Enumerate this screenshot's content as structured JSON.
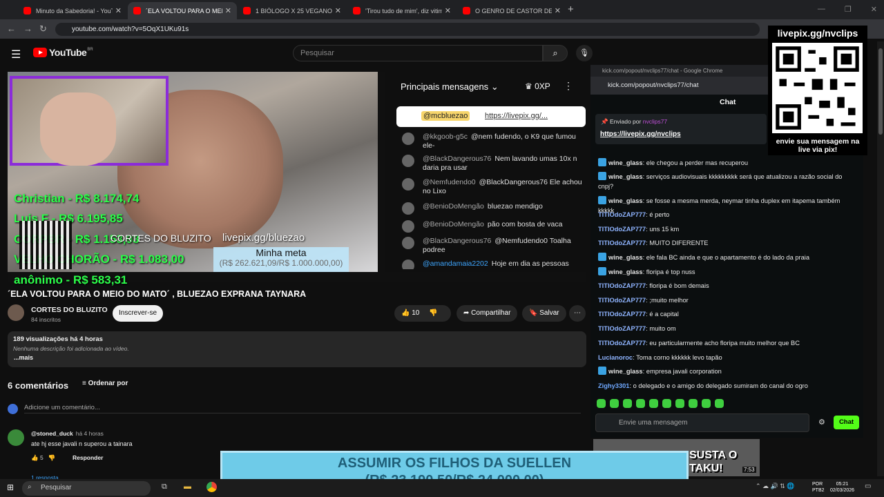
{
  "browser": {
    "tabs": [
      {
        "label": "Minuto da Sabedoria! - YouTub"
      },
      {
        "label": "´ELA VOLTOU PARA O MEIO"
      },
      {
        "label": "1 BIÓLOGO X 25 VEGANOS | FI"
      },
      {
        "label": "'Tirou tudo de mim', diz vitima"
      },
      {
        "label": "O GENRO DE CASTOR DE ANDI"
      }
    ],
    "url": "youtube.com/watch?v=5OqX1UKu91s"
  },
  "youtube": {
    "logo": "YouTube",
    "region": "BR",
    "search_placeholder": "Pesquisar"
  },
  "video": {
    "donors": [
      "Christian - R$ 8.174,74",
      "Luis F - R$ 6.195,85",
      "CORPBR - R$ 1.153,93",
      "VELHO CHORÃO - R$ 1.083,00",
      "anônimo - R$ 583,31"
    ],
    "overlay_channel": "CORTES DO BLUZITO",
    "overlay_link": "livepix.gg/bluezao",
    "meta_label": "Minha meta",
    "meta_value": "(R$ 262.621,09/R$ 1.000.000,00)"
  },
  "live_chat": {
    "title": "Principais mensagens",
    "xp": "0XP",
    "pinned_author": "@mcbluezao",
    "pinned_link": "https://livepix.gg/...",
    "messages": [
      {
        "author": "@kkgoob-g5c",
        "text": "@nem fudendo, o K9 que fumou ele-"
      },
      {
        "author": "@BlackDangerous76",
        "text": "Nem lavando umas 10x n daria pra usar"
      },
      {
        "author": "@Nemfudendo0",
        "text": "@BlackDangerous76 Ele achou no Lixo"
      },
      {
        "author": "@BenioDoMengão",
        "text": "bluezao mendigo"
      },
      {
        "author": "@BenioDoMengão",
        "text": "pão com bosta de vaca"
      },
      {
        "author": "@BlackDangerous76",
        "text": "@Nemfudendo0 Toalha podree"
      },
      {
        "author": "@amandamaia2202",
        "text": "Hoje em dia as pessoas"
      }
    ]
  },
  "watch": {
    "title": "´ELA VOLTOU PARA O MEIO DO MATO´ , BLUEZAO EXPRANA TAYNARA",
    "channel": "CORTES DO BLUZITO",
    "subs": "84 inscritos",
    "subscribe": "Inscrever-se",
    "likes": "10",
    "share": "Compartilhar",
    "save": "Salvar",
    "views": "189 visualizações  há 4 horas",
    "desc": "Nenhuma descrição foi adicionada ao vídeo.",
    "more": "...mais",
    "comment_count": "6 comentários",
    "sort": "Ordenar por",
    "add_comment": "Adicione um comentário...",
    "comment_author": "@stoned_duck",
    "comment_time": "há 4 horas",
    "comment_text": "ate hj esse javali n superou a tainara",
    "comment_likes": "5",
    "reply": "Responder",
    "replies": "1 resposta"
  },
  "kick": {
    "window_title": "kick.com/popout/nvclips77/chat - Google Chrome",
    "url": "kick.com/popout/nvclips77/chat",
    "header": "Chat",
    "pinned_by": "Enviado por",
    "pinned_user": "nvclips77",
    "pinned_link": "https://livepix.gg/nvclips",
    "messages": [
      {
        "user": "wine_glass",
        "text": "ele chegou a perder mas recuperou",
        "badge": true,
        "color": "#e6e6e6"
      },
      {
        "user": "wine_glass",
        "text": "serviços audiovisuais kkkkkkkkk será que atualizou a razão social do cnpj?",
        "badge": true,
        "color": "#e6e6e6"
      },
      {
        "user": "wine_glass",
        "text": "se fosse a mesma merda, neymar tinha duplex em itapema também kkkkk",
        "badge": true,
        "color": "#e6e6e6"
      },
      {
        "user": "TITIOdoZAP777",
        "text": "é perto",
        "badge": false,
        "color": "#8fb4ff"
      },
      {
        "user": "TITIOdoZAP777",
        "text": "uns 15 km",
        "badge": false,
        "color": "#8fb4ff"
      },
      {
        "user": "TITIOdoZAP777",
        "text": "MUITO DIFERENTE",
        "badge": false,
        "color": "#8fb4ff"
      },
      {
        "user": "wine_glass",
        "text": "ele fala BC ainda e que o apartamento é do lado da praia",
        "badge": true,
        "color": "#e6e6e6"
      },
      {
        "user": "wine_glass",
        "text": "floripa é top nuss",
        "badge": true,
        "color": "#e6e6e6"
      },
      {
        "user": "TITIOdoZAP777",
        "text": "floripa é bom demais",
        "badge": false,
        "color": "#8fb4ff"
      },
      {
        "user": "TITIOdoZAP777",
        "text": ";muito melhor",
        "badge": false,
        "color": "#8fb4ff"
      },
      {
        "user": "TITIOdoZAP777",
        "text": "é a capital",
        "badge": false,
        "color": "#8fb4ff"
      },
      {
        "user": "TITIOdoZAP777",
        "text": "muito om",
        "badge": false,
        "color": "#8fb4ff"
      },
      {
        "user": "TITIOdoZAP777",
        "text": "eu particularmente acho floripa muito melhor que BC",
        "badge": false,
        "color": "#8fb4ff"
      },
      {
        "user": "Lucianoroc",
        "text": "Toma corno kkkkkk levo tapão",
        "badge": false,
        "color": "#8fb4ff"
      },
      {
        "user": "wine_glass",
        "text": "empresa javali corporation",
        "badge": true,
        "color": "#e6e6e6"
      },
      {
        "user": "Zighy3301",
        "text": "o delegado e o amigo do delegado sumiram do canal do ogro",
        "badge": false,
        "color": "#6fa8ff"
      }
    ],
    "input_placeholder": "Envie uma mensagem",
    "send": "Chat"
  },
  "qr": {
    "head": "livepix.gg/nvclips",
    "foot": "envie sua mensagem na live via pix!"
  },
  "banner": {
    "line1": "ASSUMIR OS FILHOS DA SUELLEN",
    "line2": "(R$ 23.190,50/R$ 24.000,00)",
    "progress": 0.966
  },
  "thumb": {
    "text": "SUSTA O TAKU!",
    "time": "7:53"
  },
  "taskbar": {
    "search": "Pesquisar",
    "lang1": "POR",
    "lang2": "PTB2",
    "time": "05:21",
    "date": "02/03/2026"
  }
}
